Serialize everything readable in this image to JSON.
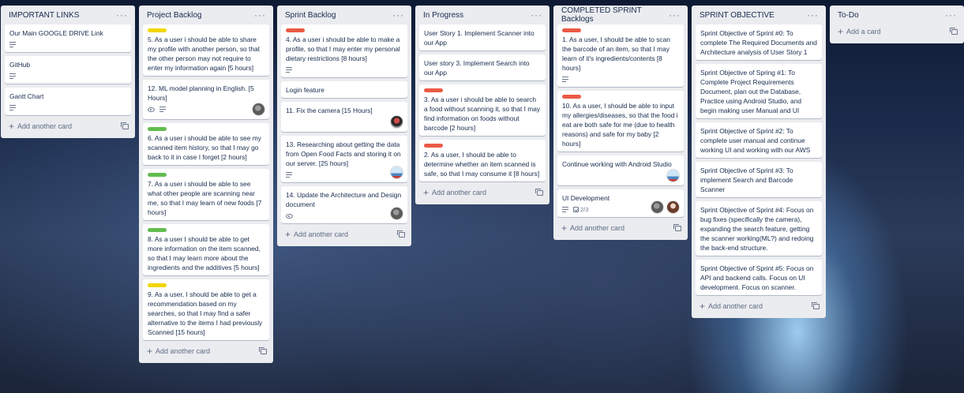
{
  "lists": [
    {
      "title": "IMPORTANT LINKS",
      "add": "Add another card",
      "cards": [
        {
          "text": "Our Main GOOGLE DRIVE Link"
        },
        {
          "text": "GitHub"
        },
        {
          "text": "Gantt Chart"
        }
      ]
    },
    {
      "title": "Project Backlog",
      "add": "Add another card",
      "cards": [
        {
          "text": "5. As a user i should be able to share my profile with another person, so that the other person may not require to enter my information again [5 hours]"
        },
        {
          "text": "12. ML model planning in English. [5 Hours]"
        },
        {
          "text": "6. As a user i should be able to see my scanned item history, so that I may go back to it in case I forget [2 hours]"
        },
        {
          "text": "7. As a user i should be able to see what other people are scanning near me, so that I may learn of new foods [7 hours]"
        },
        {
          "text": "8. As a user I should be able to get more information on the item scanned, so that I may learn more about the ingredients and the additives [5 hours]"
        },
        {
          "text": "9. As a user, I should be able to get a recommendation based on my searches, so that I may find a safer alternative to the items I had previously Scanned [15 hours]"
        }
      ]
    },
    {
      "title": "Sprint Backlog",
      "add": "Add another card",
      "cards": [
        {
          "text": "4. As a user i should be able to make a profile, so that I may enter my personal dietary restrictions [8 hours]"
        },
        {
          "text": "Login feature"
        },
        {
          "text": "11. Fix the camera [15 Hours]"
        },
        {
          "text": "13. Researching about getting the data from Open Food Facts and storing it on our server. [25 hours]"
        },
        {
          "text": "14. Update the Architecture and Design document"
        }
      ]
    },
    {
      "title": "In Progress",
      "add": "Add another card",
      "cards": [
        {
          "text": "User Story 1. Implement Scanner into our App"
        },
        {
          "text": "User story 3. Implement Search into our App"
        },
        {
          "text": "3. As a user i should be able to search a food without scanning it, so that I may find information on foods without barcode [2 hours]"
        },
        {
          "text": "2. As a user, I should be able to determine whether an item scanned is safe, so that I may consume it [8 hours]"
        }
      ]
    },
    {
      "title": "COMPLETED SPRINT Backlogs",
      "add": "Add another card",
      "cards": [
        {
          "text": "1. As a user, I should be able to scan the barcode of an item, so that I may learn of it's ingredients/contents [8 hours]"
        },
        {
          "text": "10. As a user, I should be able to input my allergies/diseases, so that the food i eat are both safe for me (due to health reasons) and safe for my baby [2 hours]"
        },
        {
          "text": "Continue working with Android Studio"
        },
        {
          "text": "UI Development",
          "checklist": "2/3"
        }
      ]
    },
    {
      "title": "SPRINT OBJECTIVE",
      "add": "Add another card",
      "cards": [
        {
          "text": "Sprint Objective of Sprint #0: To complete The Required Documents and Architecture analysis of User Story 1"
        },
        {
          "text": "Sprint Objective of Spring #1: To Complete Project Requirements Document, plan out the Database, Practice using Android Studio, and begin making user Manual and UI"
        },
        {
          "text": "Sprint Objective of Sprint #2: To complete user manual and continue working UI and working with our AWS"
        },
        {
          "text": "Sprint Objective of Sprint #3: To implement Search and Barcode Scanner"
        },
        {
          "text": "Sprint Objective of Sprint #4: Focus on bug fixes (specifically the camera), expanding the search feature, getting the scanner working(ML?) and redoing the back-end structure."
        },
        {
          "text": "Sprint Objective of Sprint #5: Focus on API and backend calls. Focus on UI development. Focus on scanner."
        }
      ]
    },
    {
      "title": "To-Do",
      "add": "Add a card",
      "cards": []
    }
  ],
  "label_colors": {
    "yellow": "#f2d600",
    "red": "#eb5a46",
    "green": "#61bd4f"
  },
  "icons": [
    "menu-dots-icon",
    "description-icon",
    "watch-eye-icon",
    "checklist-icon",
    "plus-icon",
    "card-template-icon"
  ]
}
